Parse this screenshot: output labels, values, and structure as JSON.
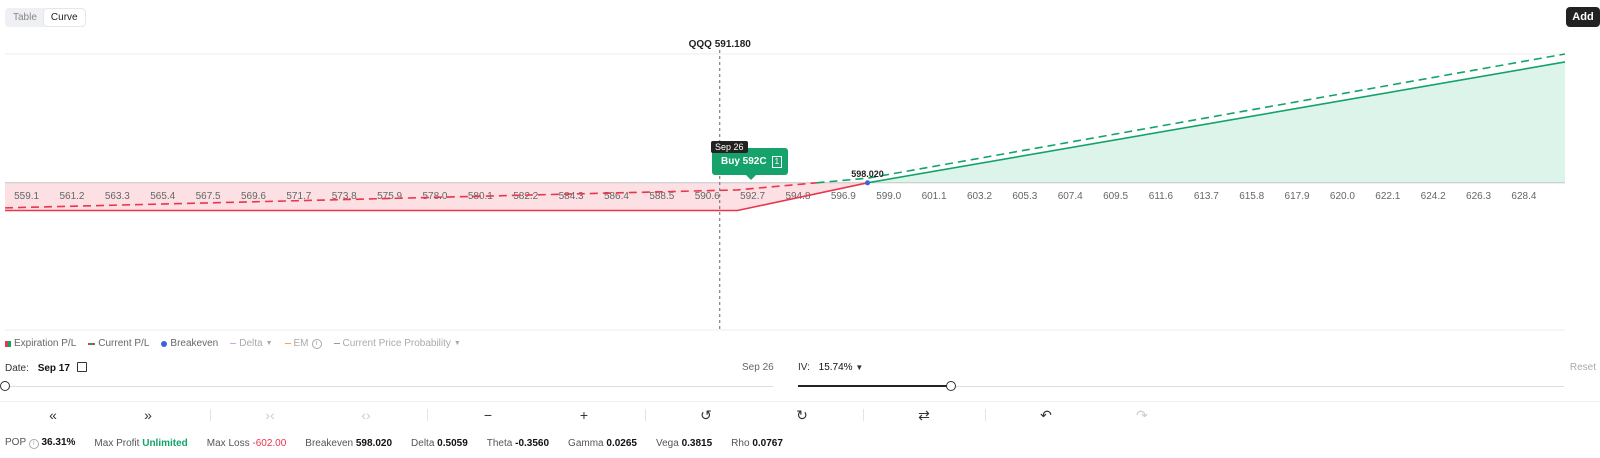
{
  "toggle": {
    "table_label": "Table",
    "curve_label": "Curve"
  },
  "add_label": "Add",
  "chart_data": {
    "type": "line",
    "title": "QQQ 591.180",
    "current_price": 591.18,
    "breakeven": 598.02,
    "breakeven_label": "598.020",
    "x_ticks": [
      "559.1",
      "561.2",
      "563.3",
      "565.4",
      "567.5",
      "569.6",
      "571.7",
      "573.8",
      "575.9",
      "578.0",
      "580.1",
      "582.2",
      "584.3",
      "586.4",
      "588.5",
      "590.6",
      "592.7",
      "594.8",
      "596.9",
      "599.0",
      "601.1",
      "603.2",
      "605.3",
      "607.4",
      "609.5",
      "611.6",
      "613.7",
      "615.8",
      "617.9",
      "620.0",
      "622.1",
      "624.2",
      "626.3",
      "628.4"
    ],
    "x_range": [
      558.1,
      630.3
    ],
    "series": [
      {
        "name": "Expiration P/L",
        "style": "solid",
        "x": [
          558.1,
          592.0,
          598.02,
          630.3
        ],
        "y": [
          -602,
          -602,
          0,
          2627
        ]
      },
      {
        "name": "Current P/L",
        "style": "dashed",
        "x": [
          558.1,
          592.0,
          598.02,
          630.3
        ],
        "y": [
          -545,
          -155,
          100,
          2800
        ]
      }
    ],
    "y_range": [
      -3200,
      2800
    ],
    "colors": {
      "profit": "#13a36a",
      "loss": "#e8364c",
      "profit_fill": "#dcf4e9",
      "loss_fill": "#fce0e4"
    }
  },
  "tooltip": {
    "date": "Sep 26",
    "label": "Buy 592C",
    "qty": "1"
  },
  "legend": [
    {
      "label": "Expiration P/L",
      "color": "#e8364c"
    },
    {
      "label": "Current P/L",
      "color": "#13a36a"
    },
    {
      "label": "Breakeven",
      "color": "#3e63dd"
    },
    {
      "label": "Delta",
      "color": "#d9a4e4"
    },
    {
      "label": "EM",
      "color": "#f5a35c"
    },
    {
      "label": "Current Price Probability",
      "color": "#999999"
    }
  ],
  "date_control": {
    "label": "Date:",
    "value": "Sep 17",
    "end_label": "Sep 26",
    "position": 0.0
  },
  "iv_control": {
    "label": "IV:",
    "value": "15.74%",
    "reset_label": "Reset",
    "position": 0.2
  },
  "toolbar": [
    {
      "icon": "«",
      "name": "shift-far-left-icon"
    },
    {
      "icon": "»",
      "name": "shift-far-right-icon"
    },
    {
      "icon": "›‹",
      "name": "zoom-in-range-icon"
    },
    {
      "icon": "‹›",
      "name": "zoom-out-range-icon"
    },
    {
      "icon": "−",
      "name": "minus-icon"
    },
    {
      "icon": "+",
      "name": "plus-icon"
    },
    {
      "icon": "↺",
      "name": "history-back-icon"
    },
    {
      "icon": "↻",
      "name": "history-forward-icon"
    },
    {
      "icon": "⇄",
      "name": "swap-icon"
    },
    {
      "icon": "↶",
      "name": "undo-icon"
    },
    {
      "icon": "↷",
      "name": "redo-icon"
    }
  ],
  "stats": {
    "pop_label": "POP",
    "pop": "36.31%",
    "max_profit_label": "Max Profit",
    "max_profit": "Unlimited",
    "max_loss_label": "Max Loss",
    "max_loss": "-602.00",
    "breakeven_label": "Breakeven",
    "breakeven": "598.020",
    "delta_label": "Delta",
    "delta": "0.5059",
    "theta_label": "Theta",
    "theta": "-0.3560",
    "gamma_label": "Gamma",
    "gamma": "0.0265",
    "vega_label": "Vega",
    "vega": "0.3815",
    "rho_label": "Rho",
    "rho": "0.0767"
  }
}
